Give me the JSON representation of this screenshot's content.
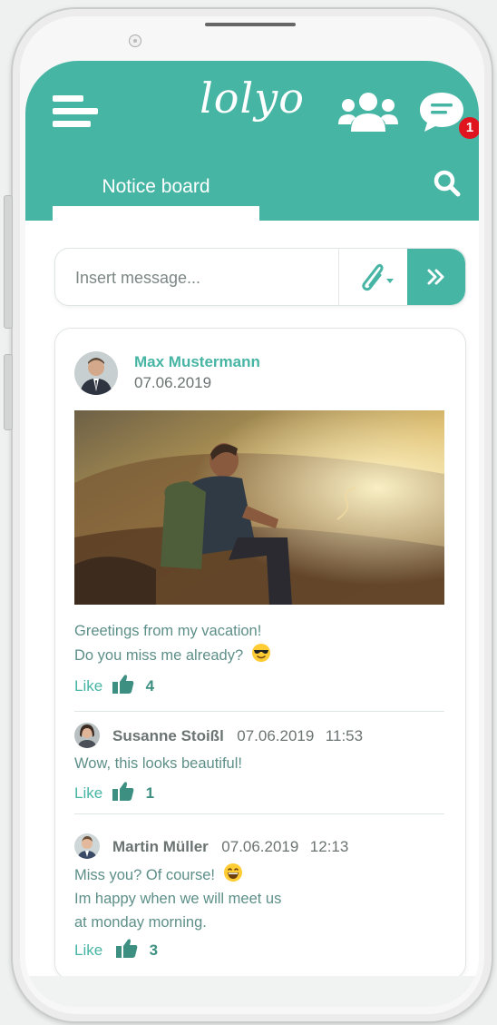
{
  "app": {
    "logo_text": "lolyo",
    "notification_count": "1"
  },
  "tabs": {
    "notice_board": "Notice board"
  },
  "composer": {
    "placeholder": "Insert message..."
  },
  "post": {
    "author": "Max Mustermann",
    "date": "07.06.2019",
    "text_line1": "Greetings from my vacation!",
    "text_line2": "Do you miss me already?",
    "like_label": "Like",
    "like_count": "4",
    "image_description": "person-sitting-on-hillside"
  },
  "comments": [
    {
      "author": "Susanne Stoißl",
      "date": "07.06.2019",
      "time": "11:53",
      "text": "Wow, this looks beautiful!",
      "like_label": "Like",
      "like_count": "1"
    },
    {
      "author": "Martin Müller",
      "date": "07.06.2019",
      "time": "12:13",
      "text_line1": "Miss you? Of course!",
      "text_line2": "Im happy when we will meet us",
      "text_line3": "at monday morning.",
      "like_label": "Like",
      "like_count": "3"
    }
  ],
  "icons": {
    "menu": "hamburger-menu-icon",
    "group": "users-group-icon",
    "chat": "chat-bubble-icon",
    "search": "search-icon",
    "attach": "paperclip-icon",
    "send": "double-chevron-right-icon",
    "like": "thumbs-up-icon"
  },
  "colors": {
    "brand": "#47b5a4",
    "badge": "#e0141e",
    "text_muted": "#6b7472"
  }
}
